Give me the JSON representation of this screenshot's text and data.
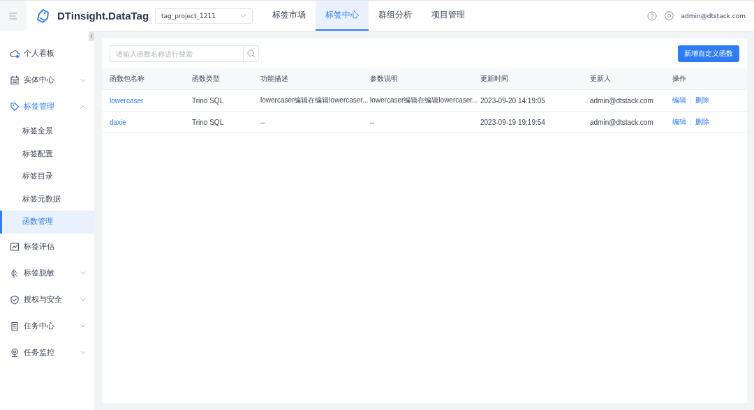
{
  "header": {
    "brand": "DTinsight.DataTag",
    "project_select": {
      "value": "tag_project_1211"
    },
    "tabs": [
      {
        "label": "标签市场",
        "selected": false
      },
      {
        "label": "标签中心",
        "selected": true
      },
      {
        "label": "群组分析",
        "selected": false
      },
      {
        "label": "项目管理",
        "selected": false
      }
    ],
    "user": "admin@dtstack.com"
  },
  "sidebar": {
    "items": [
      {
        "label": "个人看板",
        "selected": false
      },
      {
        "label": "实体中心",
        "expanded": false,
        "selected": false
      },
      {
        "label": "标签管理",
        "expanded": true,
        "selected": true,
        "children": [
          {
            "label": "标签全景",
            "selected": false
          },
          {
            "label": "标签配置",
            "selected": false
          },
          {
            "label": "标签目录",
            "selected": false
          },
          {
            "label": "标签元数据",
            "selected": false
          },
          {
            "label": "函数管理",
            "selected": true
          }
        ]
      },
      {
        "label": "标签评估",
        "selected": false
      },
      {
        "label": "标签脱敏",
        "expanded": false,
        "selected": false
      },
      {
        "label": "授权与安全",
        "expanded": false,
        "selected": false
      },
      {
        "label": "任务中心",
        "expanded": false,
        "selected": false
      },
      {
        "label": "任务监控",
        "expanded": false,
        "selected": false
      }
    ]
  },
  "toolbar": {
    "search": {
      "placeholder": "请输入函数名称进行搜索"
    },
    "add_button": "新增自定义函数"
  },
  "table": {
    "columns": [
      "函数包名称",
      "函数类型",
      "功能描述",
      "参数说明",
      "更新时间",
      "更新人",
      "操作"
    ],
    "rows": [
      {
        "name": "lowercaser",
        "type": "Trino SQL",
        "description": "lowercaser编辑在编辑lowercaser...",
        "params": "lowercaser编辑在编辑lowercaser...",
        "updated_at": "2023-09-20 14:19:05",
        "updated_by": "admin@dtstack.com",
        "actions": [
          "编辑",
          "删除"
        ]
      },
      {
        "name": "daxie",
        "type": "Trino SQL",
        "description": "--",
        "params": "--",
        "updated_at": "2023-09-19 19:19:54",
        "updated_by": "admin@dtstack.com",
        "actions": [
          "编辑",
          "删除"
        ]
      }
    ]
  }
}
